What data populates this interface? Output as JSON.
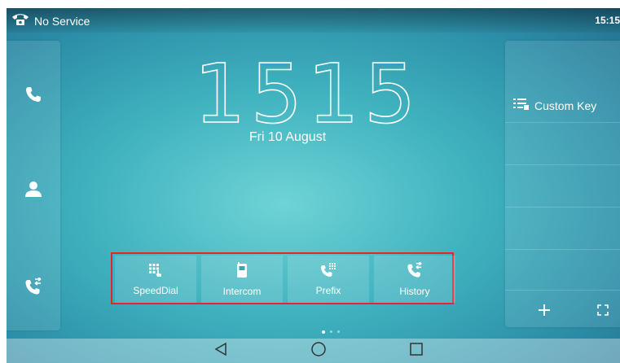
{
  "status_bar": {
    "service_text": "No Service",
    "time": "15:15",
    "service_icon": "phone-handset-icon"
  },
  "clock": {
    "time": "1515",
    "date": "Fri 10 August"
  },
  "left_panel": {
    "items": [
      {
        "icon": "phone-icon"
      },
      {
        "icon": "contact-person-icon"
      },
      {
        "icon": "call-history-icon"
      }
    ]
  },
  "right_panel": {
    "custom_key_label": "Custom Key",
    "custom_key_icon": "list-icon",
    "add_icon": "plus-icon",
    "expand_icon": "expand-icon"
  },
  "dock": {
    "highlight_color": "#e4262a",
    "items": [
      {
        "label": "SpeedDial",
        "icon": "speed-dial-icon"
      },
      {
        "label": "Intercom",
        "icon": "intercom-icon"
      },
      {
        "label": "Prefix",
        "icon": "prefix-dialpad-icon"
      },
      {
        "label": "History",
        "icon": "history-icon"
      }
    ]
  },
  "page_indicator": {
    "pages": 3,
    "current": 1
  },
  "nav_bar": {
    "back_icon": "back-triangle-icon",
    "home_icon": "home-circle-icon",
    "recents_icon": "recents-square-icon"
  }
}
